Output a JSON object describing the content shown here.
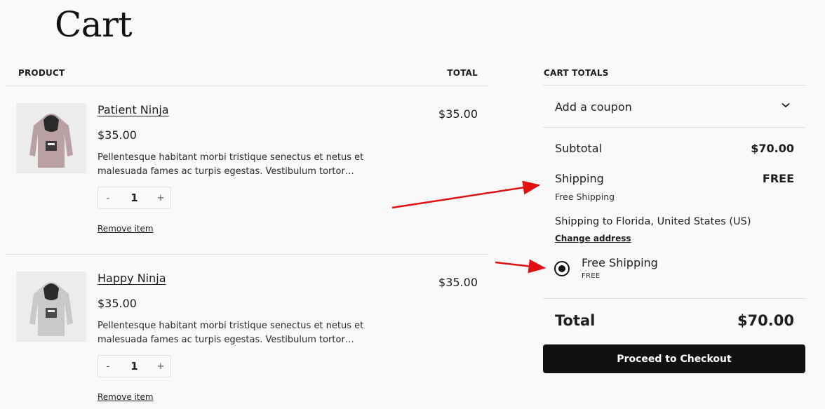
{
  "page": {
    "title": "Cart"
  },
  "cart": {
    "headers": {
      "product": "PRODUCT",
      "total": "TOTAL"
    },
    "items": [
      {
        "name": "Patient Ninja",
        "price": "$35.00",
        "description": "Pellentesque habitant morbi tristique senectus et netus et malesuada fames ac turpis egestas. Vestibulum tortor…",
        "quantity": "1",
        "decrement": "-",
        "increment": "+",
        "remove_label": "Remove item",
        "line_total": "$35.00",
        "hoodie_color": "#b8a0a3"
      },
      {
        "name": "Happy Ninja",
        "price": "$35.00",
        "description": "Pellentesque habitant morbi tristique senectus et netus et malesuada fames ac turpis egestas. Vestibulum tortor…",
        "quantity": "1",
        "decrement": "-",
        "increment": "+",
        "remove_label": "Remove item",
        "line_total": "$35.00",
        "hoodie_color": "#c9c9c9"
      }
    ]
  },
  "totals": {
    "heading": "CART TOTALS",
    "coupon_label": "Add a coupon",
    "subtotal_label": "Subtotal",
    "subtotal_value": "$70.00",
    "shipping_label": "Shipping",
    "shipping_value": "FREE",
    "shipping_method_summary": "Free Shipping",
    "shipping_destination": "Shipping to Florida, United States (US)",
    "change_address_label": "Change address",
    "method_name": "Free Shipping",
    "method_cost": "FREE",
    "total_label": "Total",
    "total_value": "$70.00",
    "checkout_label": "Proceed to Checkout"
  },
  "colors": {
    "annotation_arrow": "#e01010",
    "checkout_button": "#111111"
  }
}
